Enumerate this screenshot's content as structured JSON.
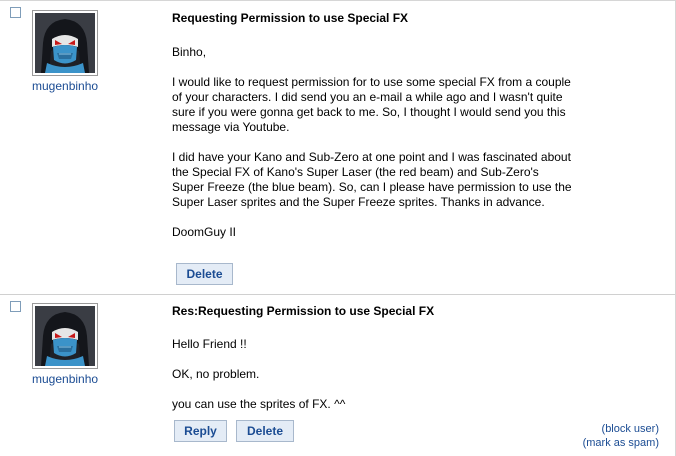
{
  "messages": [
    {
      "username": "mugenbinho",
      "subject": "Requesting Permission to use Special FX",
      "paragraphs": [
        "Binho,",
        "I would like to request permission for to use some special FX from a couple of your characters. I did send you an e-mail a while ago and I wasn't quite sure if you were gonna get back to me. So, I thought I would send you this message via Youtube.",
        "I did have your Kano and Sub-Zero at one point and I was fascinated about the Special FX of Kano's Super Laser (the red beam) and Sub-Zero's Super Freeze (the blue beam). So, can I please have permission to use the Super Laser sprites and the Super Freeze sprites. Thanks in advance.",
        "DoomGuy II"
      ],
      "delete_label": "Delete"
    },
    {
      "username": "mugenbinho",
      "subject": "Res:Requesting Permission to use Special FX",
      "paragraphs": [
        "Hello Friend !!",
        "OK, no problem.",
        "you can use the sprites of FX. ^^"
      ],
      "reply_label": "Reply",
      "delete_label": "Delete",
      "block_user_label": "block user",
      "mark_spam_label": "mark as spam"
    }
  ],
  "colors": {
    "link": "#1b4c93",
    "button_bg": "#e4ecf6",
    "button_border": "#a8b8cc"
  },
  "icons": {
    "avatar": "sub-zero-ninja-avatar"
  }
}
